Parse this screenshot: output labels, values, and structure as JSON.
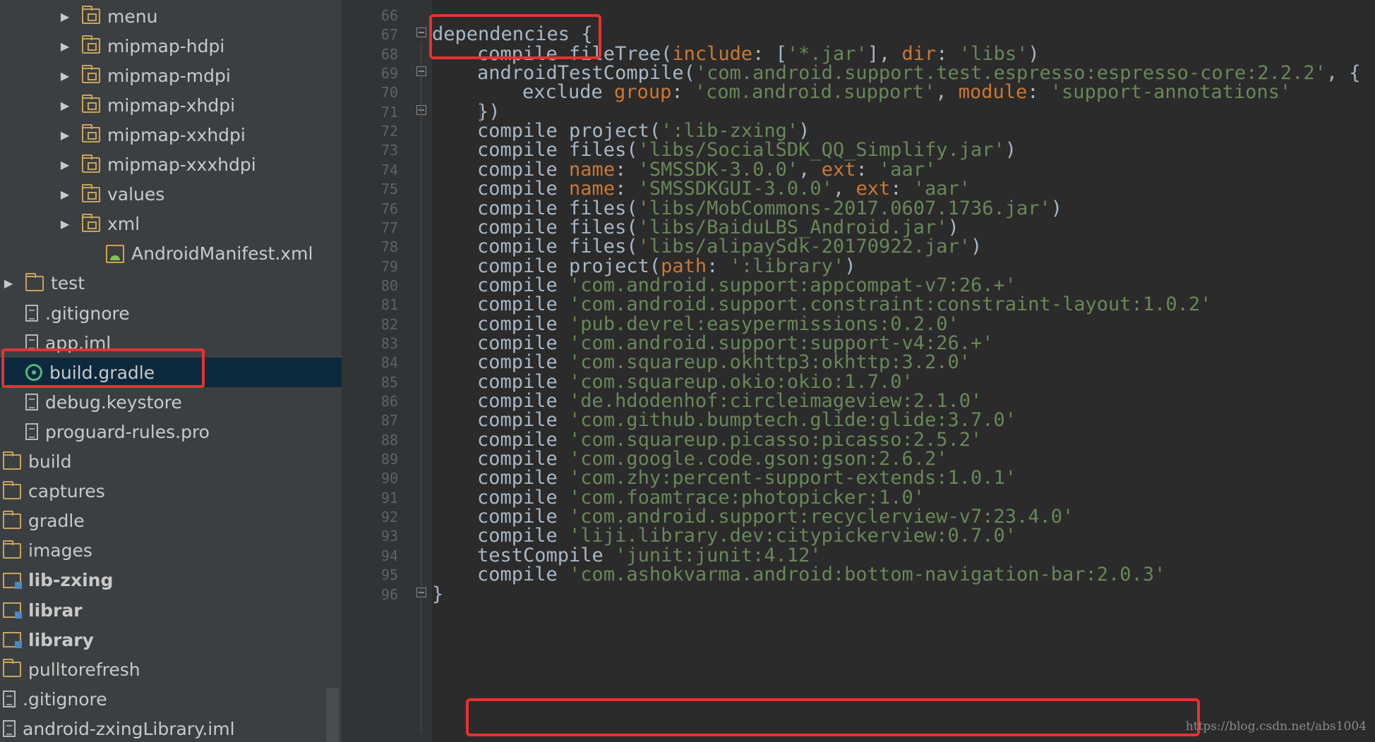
{
  "project_tree": {
    "items": [
      {
        "label": "menu",
        "icon": "res-folder-icon",
        "indent": 2,
        "arrow": true
      },
      {
        "label": "mipmap-hdpi",
        "icon": "res-folder-icon",
        "indent": 2,
        "arrow": true
      },
      {
        "label": "mipmap-mdpi",
        "icon": "res-folder-icon",
        "indent": 2,
        "arrow": true
      },
      {
        "label": "mipmap-xhdpi",
        "icon": "res-folder-icon",
        "indent": 2,
        "arrow": true
      },
      {
        "label": "mipmap-xxhdpi",
        "icon": "res-folder-icon",
        "indent": 2,
        "arrow": true
      },
      {
        "label": "mipmap-xxxhdpi",
        "icon": "res-folder-icon",
        "indent": 2,
        "arrow": true
      },
      {
        "label": "values",
        "icon": "res-folder-icon",
        "indent": 2,
        "arrow": true
      },
      {
        "label": "xml",
        "icon": "res-folder-icon",
        "indent": 2,
        "arrow": true
      },
      {
        "label": "AndroidManifest.xml",
        "icon": "manifest-icon",
        "indent": 3,
        "arrow": false
      },
      {
        "label": "test",
        "icon": "folder-icon",
        "indent": 1,
        "arrow": true
      },
      {
        "label": ".gitignore",
        "icon": "file-icon",
        "indent": 1,
        "arrow": false
      },
      {
        "label": "app.iml",
        "icon": "file-icon",
        "indent": 1,
        "arrow": false
      },
      {
        "label": "build.gradle",
        "icon": "gradle-icon",
        "indent": 1,
        "arrow": false,
        "selected": true
      },
      {
        "label": "debug.keystore",
        "icon": "file-icon",
        "indent": 1,
        "arrow": false
      },
      {
        "label": "proguard-rules.pro",
        "icon": "file-icon",
        "indent": 1,
        "arrow": false
      },
      {
        "label": "build",
        "icon": "folder-icon",
        "indent": 0,
        "arrow": false
      },
      {
        "label": "captures",
        "icon": "folder-icon",
        "indent": 0,
        "arrow": false
      },
      {
        "label": "gradle",
        "icon": "folder-icon",
        "indent": 0,
        "arrow": false
      },
      {
        "label": "images",
        "icon": "folder-icon",
        "indent": 0,
        "arrow": false
      },
      {
        "label": "lib-zxing",
        "icon": "module-icon",
        "indent": 0,
        "arrow": false,
        "bold": true
      },
      {
        "label": "librar",
        "icon": "module-icon",
        "indent": 0,
        "arrow": false,
        "bold": true
      },
      {
        "label": "library",
        "icon": "module-icon",
        "indent": 0,
        "arrow": false,
        "bold": true
      },
      {
        "label": "pulltorefresh",
        "icon": "folder-icon",
        "indent": 0,
        "arrow": false
      },
      {
        "label": ".gitignore",
        "icon": "file-icon",
        "indent": 0,
        "arrow": false
      },
      {
        "label": "android-zxingLibrary.iml",
        "icon": "file-icon",
        "indent": 0,
        "arrow": false
      }
    ]
  },
  "editor": {
    "lines": [
      {
        "n": "66",
        "indent": 0,
        "tokens": []
      },
      {
        "n": "67",
        "indent": 0,
        "tokens": [
          {
            "t": "dependencies {",
            "c": "kw"
          }
        ]
      },
      {
        "n": "68",
        "indent": 1,
        "tokens": [
          {
            "t": "compile fileTree(",
            "c": "kw"
          },
          {
            "t": "include",
            "c": "named"
          },
          {
            "t": ": [",
            "c": "kw"
          },
          {
            "t": "'*.jar'",
            "c": "str"
          },
          {
            "t": "], ",
            "c": "kw"
          },
          {
            "t": "dir",
            "c": "named"
          },
          {
            "t": ": ",
            "c": "kw"
          },
          {
            "t": "'libs'",
            "c": "str"
          },
          {
            "t": ")",
            "c": "kw"
          }
        ]
      },
      {
        "n": "69",
        "indent": 1,
        "tokens": [
          {
            "t": "androidTestCompile(",
            "c": "kw"
          },
          {
            "t": "'com.android.support.test.espresso:espresso-core:2.2.2'",
            "c": "str"
          },
          {
            "t": ", {",
            "c": "kw"
          }
        ]
      },
      {
        "n": "70",
        "indent": 2,
        "tokens": [
          {
            "t": "exclude ",
            "c": "kw"
          },
          {
            "t": "group",
            "c": "named"
          },
          {
            "t": ": ",
            "c": "kw"
          },
          {
            "t": "'com.android.support'",
            "c": "str"
          },
          {
            "t": ", ",
            "c": "kw"
          },
          {
            "t": "module",
            "c": "named"
          },
          {
            "t": ": ",
            "c": "kw"
          },
          {
            "t": "'support-annotations'",
            "c": "str"
          }
        ]
      },
      {
        "n": "71",
        "indent": 1,
        "tokens": [
          {
            "t": "})",
            "c": "kw"
          }
        ]
      },
      {
        "n": "72",
        "indent": 1,
        "tokens": [
          {
            "t": "compile project(",
            "c": "kw"
          },
          {
            "t": "':lib-zxing'",
            "c": "str"
          },
          {
            "t": ")",
            "c": "kw"
          }
        ]
      },
      {
        "n": "73",
        "indent": 1,
        "tokens": [
          {
            "t": "compile files(",
            "c": "kw"
          },
          {
            "t": "'libs/SocialSDK_QQ_Simplify.jar'",
            "c": "str"
          },
          {
            "t": ")",
            "c": "kw"
          }
        ]
      },
      {
        "n": "74",
        "indent": 1,
        "tokens": [
          {
            "t": "compile ",
            "c": "kw"
          },
          {
            "t": "name",
            "c": "named"
          },
          {
            "t": ": ",
            "c": "kw"
          },
          {
            "t": "'SMSSDK-3.0.0'",
            "c": "str"
          },
          {
            "t": ", ",
            "c": "kw"
          },
          {
            "t": "ext",
            "c": "named"
          },
          {
            "t": ": ",
            "c": "kw"
          },
          {
            "t": "'aar'",
            "c": "str"
          }
        ]
      },
      {
        "n": "75",
        "indent": 1,
        "tokens": [
          {
            "t": "compile ",
            "c": "kw"
          },
          {
            "t": "name",
            "c": "named"
          },
          {
            "t": ": ",
            "c": "kw"
          },
          {
            "t": "'SMSSDKGUI-3.0.0'",
            "c": "str"
          },
          {
            "t": ", ",
            "c": "kw"
          },
          {
            "t": "ext",
            "c": "named"
          },
          {
            "t": ": ",
            "c": "kw"
          },
          {
            "t": "'aar'",
            "c": "str"
          }
        ]
      },
      {
        "n": "76",
        "indent": 1,
        "tokens": [
          {
            "t": "compile files(",
            "c": "kw"
          },
          {
            "t": "'libs/MobCommons-2017.0607.1736.jar'",
            "c": "str"
          },
          {
            "t": ")",
            "c": "kw"
          }
        ]
      },
      {
        "n": "77",
        "indent": 1,
        "tokens": [
          {
            "t": "compile files(",
            "c": "kw"
          },
          {
            "t": "'libs/BaiduLBS_Android.jar'",
            "c": "str"
          },
          {
            "t": ")",
            "c": "kw"
          }
        ]
      },
      {
        "n": "78",
        "indent": 1,
        "tokens": [
          {
            "t": "compile files(",
            "c": "kw"
          },
          {
            "t": "'libs/alipaySdk-20170922.jar'",
            "c": "str"
          },
          {
            "t": ")",
            "c": "kw"
          }
        ]
      },
      {
        "n": "79",
        "indent": 1,
        "tokens": [
          {
            "t": "compile project(",
            "c": "kw"
          },
          {
            "t": "path",
            "c": "named"
          },
          {
            "t": ": ",
            "c": "kw"
          },
          {
            "t": "':library'",
            "c": "str"
          },
          {
            "t": ")",
            "c": "kw"
          }
        ]
      },
      {
        "n": "80",
        "indent": 1,
        "tokens": [
          {
            "t": "compile ",
            "c": "kw"
          },
          {
            "t": "'com.android.support:appcompat-v7:26.+'",
            "c": "str"
          }
        ]
      },
      {
        "n": "81",
        "indent": 1,
        "tokens": [
          {
            "t": "compile ",
            "c": "kw"
          },
          {
            "t": "'com.android.support.constraint:constraint-layout:1.0.2'",
            "c": "str"
          }
        ]
      },
      {
        "n": "82",
        "indent": 1,
        "tokens": [
          {
            "t": "compile ",
            "c": "kw"
          },
          {
            "t": "'pub.devrel:easypermissions:0.2.0'",
            "c": "str"
          }
        ]
      },
      {
        "n": "83",
        "indent": 1,
        "tokens": [
          {
            "t": "compile ",
            "c": "kw"
          },
          {
            "t": "'com.android.support:support-v4:26.+'",
            "c": "str"
          }
        ]
      },
      {
        "n": "84",
        "indent": 1,
        "tokens": [
          {
            "t": "compile ",
            "c": "kw"
          },
          {
            "t": "'com.squareup.okhttp3:okhttp:3.2.0'",
            "c": "str"
          }
        ]
      },
      {
        "n": "85",
        "indent": 1,
        "tokens": [
          {
            "t": "compile ",
            "c": "kw"
          },
          {
            "t": "'com.squareup.okio:okio:1.7.0'",
            "c": "str"
          }
        ]
      },
      {
        "n": "86",
        "indent": 1,
        "tokens": [
          {
            "t": "compile ",
            "c": "kw"
          },
          {
            "t": "'de.hdodenhof:circleimageview:2.1.0'",
            "c": "str"
          }
        ]
      },
      {
        "n": "87",
        "indent": 1,
        "tokens": [
          {
            "t": "compile ",
            "c": "kw"
          },
          {
            "t": "'com.github.bumptech.glide:glide:3.7.0'",
            "c": "str"
          }
        ]
      },
      {
        "n": "88",
        "indent": 1,
        "tokens": [
          {
            "t": "compile ",
            "c": "kw"
          },
          {
            "t": "'com.squareup.picasso:picasso:2.5.2'",
            "c": "str"
          }
        ]
      },
      {
        "n": "89",
        "indent": 1,
        "tokens": [
          {
            "t": "compile ",
            "c": "kw"
          },
          {
            "t": "'com.google.code.gson:gson:2.6.2'",
            "c": "str"
          }
        ]
      },
      {
        "n": "90",
        "indent": 1,
        "tokens": [
          {
            "t": "compile ",
            "c": "kw"
          },
          {
            "t": "'com.zhy:percent-support-extends:1.0.1'",
            "c": "str"
          }
        ]
      },
      {
        "n": "91",
        "indent": 1,
        "tokens": [
          {
            "t": "compile ",
            "c": "kw"
          },
          {
            "t": "'com.foamtrace:photopicker:1.0'",
            "c": "str"
          }
        ]
      },
      {
        "n": "92",
        "indent": 1,
        "tokens": [
          {
            "t": "compile ",
            "c": "kw"
          },
          {
            "t": "'com.android.support:recyclerview-v7:23.4.0'",
            "c": "str"
          }
        ]
      },
      {
        "n": "93",
        "indent": 1,
        "tokens": [
          {
            "t": "compile ",
            "c": "kw"
          },
          {
            "t": "'liji.library.dev:citypickerview:0.7.0'",
            "c": "str"
          }
        ]
      },
      {
        "n": "94",
        "indent": 1,
        "tokens": [
          {
            "t": "testCompile ",
            "c": "kw"
          },
          {
            "t": "'junit:junit:4.12'",
            "c": "str"
          }
        ]
      },
      {
        "n": "95",
        "indent": 1,
        "tokens": [
          {
            "t": "compile ",
            "c": "kw"
          },
          {
            "t": "'com.ashokvarma.android:bottom-navigation-bar:2.0.3'",
            "c": "str"
          }
        ]
      },
      {
        "n": "96",
        "indent": 0,
        "tokens": [
          {
            "t": "}",
            "c": "kw"
          }
        ]
      }
    ]
  },
  "watermark": "https://blog.csdn.net/abs1004",
  "colors": {
    "tree_bg": "#3c3f41",
    "editor_bg": "#2b2b2b",
    "gutter_bg": "#313335",
    "string": "#6a8759",
    "named_arg": "#cc7832",
    "text": "#a9b7c6",
    "highlight_box": "#e53232",
    "selection": "#0d293e"
  }
}
